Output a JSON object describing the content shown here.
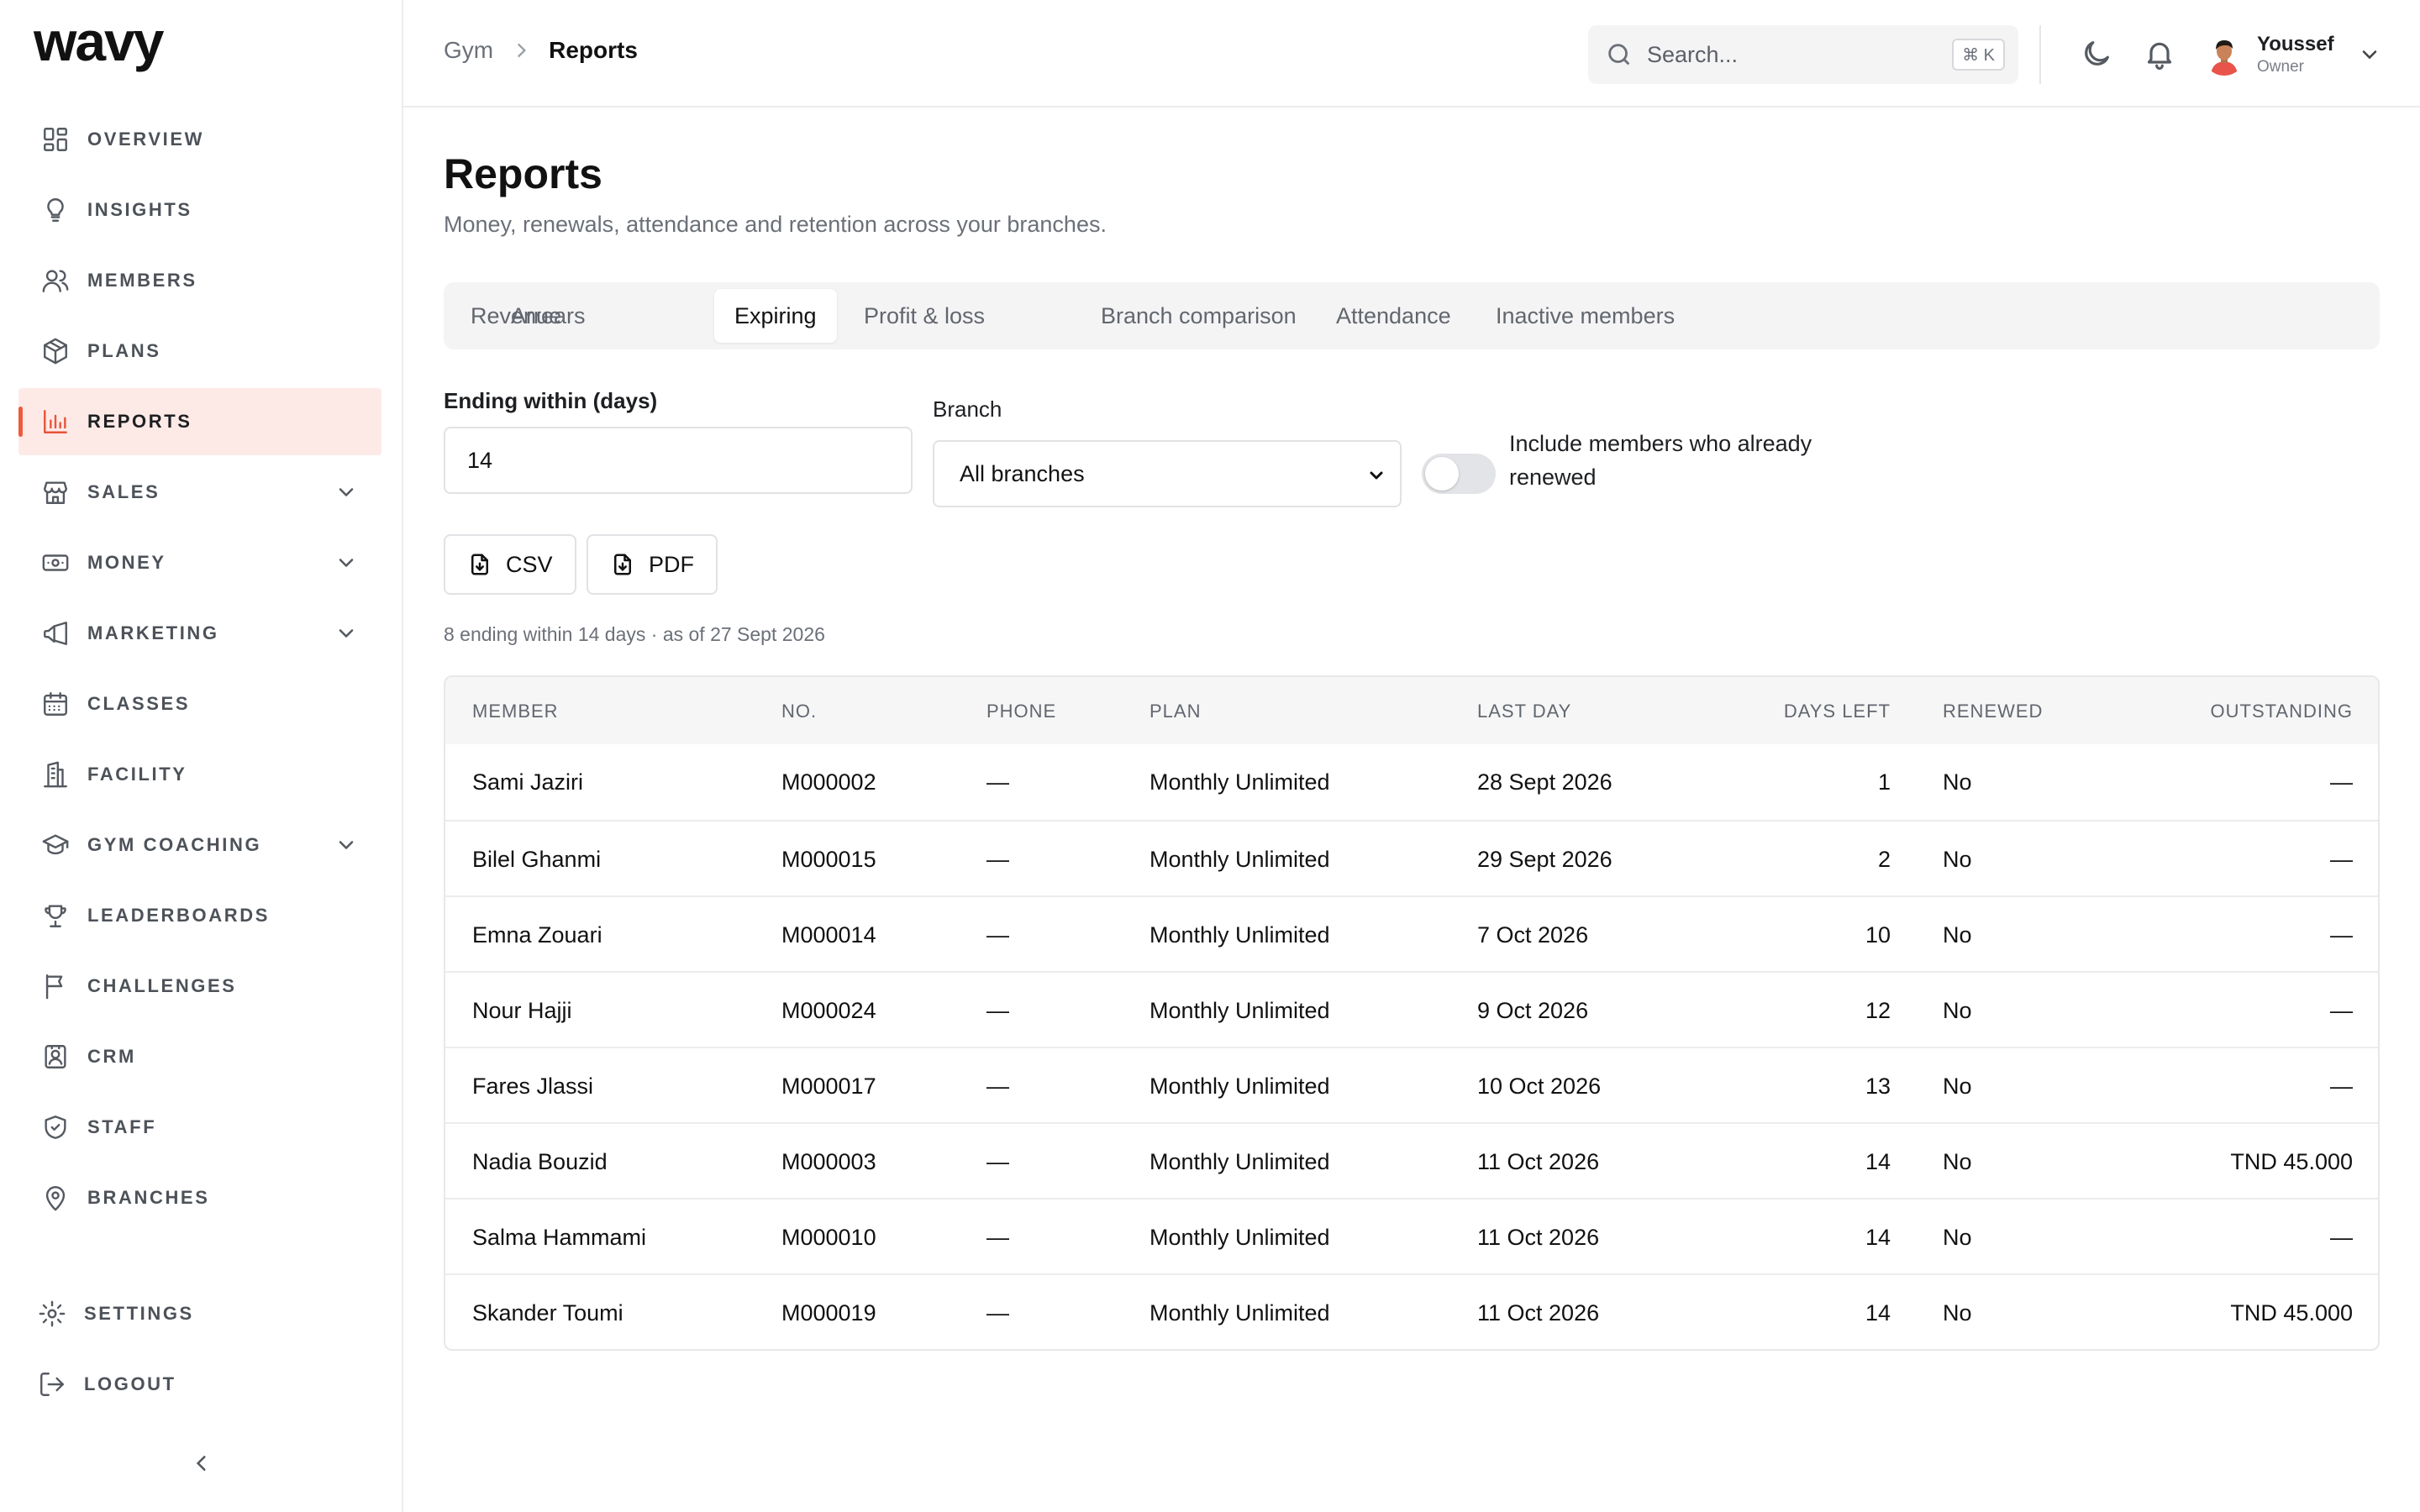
{
  "app": {
    "logo": "wavy"
  },
  "sidebar": {
    "items": [
      {
        "id": "overview",
        "label": "OVERVIEW",
        "icon": "layout-grid-icon",
        "active": false,
        "expandable": false
      },
      {
        "id": "insights",
        "label": "INSIGHTS",
        "icon": "lightbulb-icon",
        "active": false,
        "expandable": false
      },
      {
        "id": "members",
        "label": "MEMBERS",
        "icon": "users-icon",
        "active": false,
        "expandable": false
      },
      {
        "id": "plans",
        "label": "PLANS",
        "icon": "package-icon",
        "active": false,
        "expandable": false
      },
      {
        "id": "reports",
        "label": "REPORTS",
        "icon": "bar-chart-icon",
        "active": true,
        "expandable": false
      },
      {
        "id": "sales",
        "label": "SALES",
        "icon": "store-icon",
        "active": false,
        "expandable": true
      },
      {
        "id": "money",
        "label": "MONEY",
        "icon": "banknote-icon",
        "active": false,
        "expandable": true
      },
      {
        "id": "marketing",
        "label": "MARKETING",
        "icon": "megaphone-icon",
        "active": false,
        "expandable": true
      },
      {
        "id": "classes",
        "label": "CLASSES",
        "icon": "calendar-icon",
        "active": false,
        "expandable": false
      },
      {
        "id": "facility",
        "label": "FACILITY",
        "icon": "building-icon",
        "active": false,
        "expandable": false
      },
      {
        "id": "gym-coaching",
        "label": "GYM COACHING",
        "icon": "graduation-cap-icon",
        "active": false,
        "expandable": true
      },
      {
        "id": "leaderboards",
        "label": "LEADERBOARDS",
        "icon": "trophy-icon",
        "active": false,
        "expandable": false
      },
      {
        "id": "challenges",
        "label": "CHALLENGES",
        "icon": "flag-icon",
        "active": false,
        "expandable": false
      },
      {
        "id": "crm",
        "label": "CRM",
        "icon": "contact-icon",
        "active": false,
        "expandable": false
      },
      {
        "id": "staff",
        "label": "STAFF",
        "icon": "shield-check-icon",
        "active": false,
        "expandable": false
      },
      {
        "id": "branches",
        "label": "BRANCHES",
        "icon": "map-pin-icon",
        "active": false,
        "expandable": false
      }
    ],
    "bottom": [
      {
        "id": "settings",
        "label": "SETTINGS",
        "icon": "gear-icon"
      },
      {
        "id": "logout",
        "label": "LOGOUT",
        "icon": "logout-icon"
      }
    ]
  },
  "header": {
    "breadcrumb": [
      "Gym",
      "Reports"
    ],
    "search_placeholder": "Search...",
    "search_shortcut": "⌘ K",
    "user": {
      "name": "Youssef",
      "role": "Owner"
    }
  },
  "page": {
    "title": "Reports",
    "subtitle": "Money, renewals, attendance and retention across your branches.",
    "tabs": [
      {
        "label": "Revenue",
        "active": false
      },
      {
        "label": "Arrears",
        "active": false
      },
      {
        "label": "Expiring",
        "active": true
      },
      {
        "label": "Profit & loss",
        "active": false
      },
      {
        "label": "Branch comparison",
        "active": false
      },
      {
        "label": "Attendance",
        "active": false
      },
      {
        "label": "Inactive members",
        "active": false
      }
    ],
    "filters": {
      "ending_label": "Ending within (days)",
      "ending_value": "14",
      "branch_label": "Branch",
      "branch_value": "All branches",
      "toggle_label": "Include members who already renewed",
      "toggle_on": false
    },
    "actions": {
      "csv": "CSV",
      "pdf": "PDF"
    },
    "summary": "8 ending within 14 days · as of 27 Sept 2026"
  },
  "table": {
    "columns": [
      "MEMBER",
      "NO.",
      "PHONE",
      "PLAN",
      "LAST DAY",
      "DAYS LEFT",
      "RENEWED",
      "OUTSTANDING"
    ],
    "rows": [
      [
        "Sami Jaziri",
        "M000002",
        "—",
        "Monthly Unlimited",
        "28 Sept 2026",
        "1",
        "No",
        "—"
      ],
      [
        "Bilel Ghanmi",
        "M000015",
        "—",
        "Monthly Unlimited",
        "29 Sept 2026",
        "2",
        "No",
        "—"
      ],
      [
        "Emna Zouari",
        "M000014",
        "—",
        "Monthly Unlimited",
        "7 Oct 2026",
        "10",
        "No",
        "—"
      ],
      [
        "Nour Hajji",
        "M000024",
        "—",
        "Monthly Unlimited",
        "9 Oct 2026",
        "12",
        "No",
        "—"
      ],
      [
        "Fares Jlassi",
        "M000017",
        "—",
        "Monthly Unlimited",
        "10 Oct 2026",
        "13",
        "No",
        "—"
      ],
      [
        "Nadia Bouzid",
        "M000003",
        "—",
        "Monthly Unlimited",
        "11 Oct 2026",
        "14",
        "No",
        "TND 45.000"
      ],
      [
        "Salma Hammami",
        "M000010",
        "—",
        "Monthly Unlimited",
        "11 Oct 2026",
        "14",
        "No",
        "—"
      ],
      [
        "Skander Toumi",
        "M000019",
        "—",
        "Monthly Unlimited",
        "11 Oct 2026",
        "14",
        "No",
        "TND 45.000"
      ]
    ]
  },
  "colors": {
    "accent": "#ef5a3c",
    "active_bg": "#fdeae7",
    "muted_text": "#6b7078"
  }
}
